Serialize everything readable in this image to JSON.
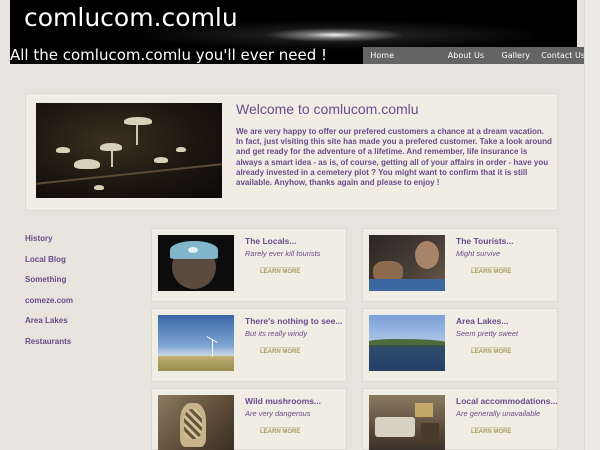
{
  "header": {
    "site_title": "comlucom.comlu",
    "tagline": "All the comlucom.comlu you'll ever need !"
  },
  "nav": [
    {
      "label": "Home"
    },
    {
      "label": "About Us"
    },
    {
      "label": "Gallery"
    },
    {
      "label": "Contact Us"
    }
  ],
  "welcome": {
    "title": "Welcome to comlucom.comlu",
    "text": "We are very happy to offer our prefered customers a chance at a dream vacation. In fact, just visiting this site has made you a prefered customer. Take a look around and get ready for the adventure of a lifetime. And remember, life insurance is always a smart idea - as is, of course, getting all of your affairs in order - have you already invested in a cemetery plot ? You might want to confirm that it is still available. Anyhow, thanks again and please to enjoy !"
  },
  "sidebar": [
    {
      "label": "History"
    },
    {
      "label": "Local Blog"
    },
    {
      "label": "Something"
    },
    {
      "label": "comeze.com"
    },
    {
      "label": "Area Lakes"
    },
    {
      "label": "Restaurants"
    }
  ],
  "cards": [
    {
      "title": "The Locals...",
      "subtitle": "Rarely ever kill tourists",
      "more": "LEARN MORE"
    },
    {
      "title": "The Tourists...",
      "subtitle": "Might survive",
      "more": "LEARN MORE"
    },
    {
      "title": "There's nothing to see...",
      "subtitle": "But its really windy",
      "more": "LEARN MORE"
    },
    {
      "title": "Area Lakes...",
      "subtitle": "Seem pretty sweet",
      "more": "LEARN MORE"
    },
    {
      "title": "Wild mushrooms...",
      "subtitle": "Are very dangerous",
      "more": "LEARN MORE"
    },
    {
      "title": "Local accommodations...",
      "subtitle": "Are generally unavailable",
      "more": "LEARN MORE"
    }
  ]
}
